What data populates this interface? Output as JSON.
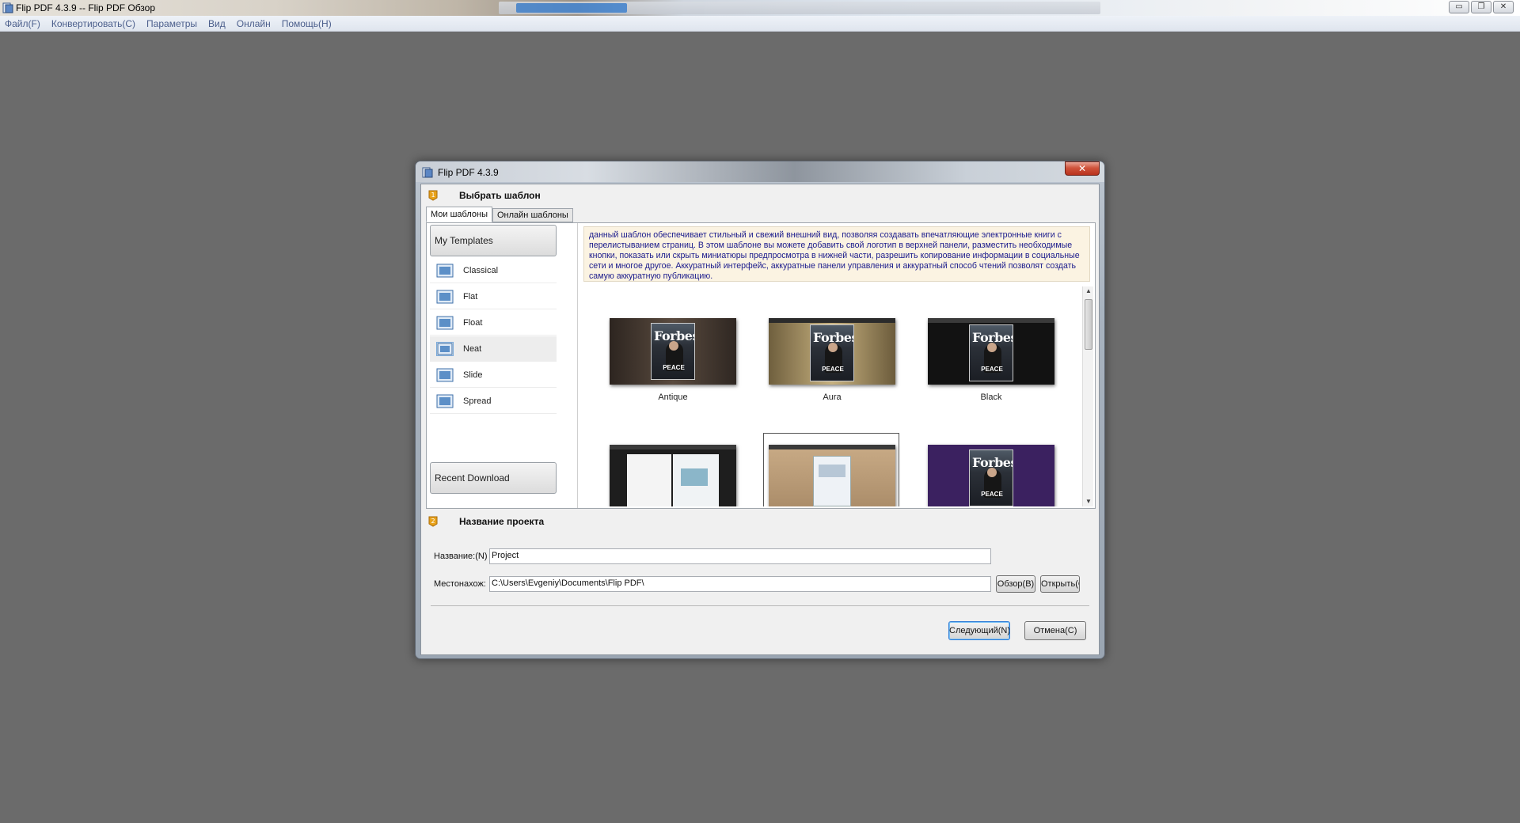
{
  "app": {
    "title": "Flip PDF 4.3.9  -- Flip PDF Обзор",
    "window_buttons": {
      "minimize": "▭",
      "restore": "❐",
      "close": "✕"
    }
  },
  "menu": {
    "items": [
      {
        "label": "Файл(F)"
      },
      {
        "label": "Конвертировать(C)"
      },
      {
        "label": "Параметры"
      },
      {
        "label": "Вид"
      },
      {
        "label": "Онлайн"
      },
      {
        "label": "Помощь(H)"
      }
    ]
  },
  "dialog": {
    "title": "Flip PDF 4.3.9",
    "close_label": "✕",
    "section1": {
      "number": "1",
      "title": "Выбрать шаблон"
    },
    "tabs": [
      {
        "label": "Мои шаблоны",
        "active": true
      },
      {
        "label": "Онлайн шаблоны",
        "active": false
      }
    ],
    "templates": {
      "header": "My Templates",
      "items": [
        {
          "label": "Classical"
        },
        {
          "label": "Flat"
        },
        {
          "label": "Float"
        },
        {
          "label": "Neat",
          "selected": true
        },
        {
          "label": "Slide"
        },
        {
          "label": "Spread"
        }
      ],
      "footer": "Recent Download"
    },
    "description": "данный шаблон обеспечивает стильный и свежий внешний вид, позволяя создавать впечатляющие электронные книги с перелистыванием страниц. В этом шаблоне вы можете добавить свой логотип в верхней панели, разместить необходимые кнопки, показать или скрыть миниатюры предпросмотра в нижней части, разрешить копирование информации в социальные сети и многое другое. Аккуратный интерфейс, аккуратные панели управления и аккуратный способ чтений позволят создать самую аккуратную публикацию.",
    "thumbnails": [
      {
        "label": "Antique",
        "cover_title": "Forbes",
        "cover_caption": "PEACE",
        "bg": "#4a3f36"
      },
      {
        "label": "Aura",
        "cover_title": "Forbes",
        "cover_caption": "PEACE",
        "bg": "#a48e61"
      },
      {
        "label": "Black",
        "cover_title": "Forbes",
        "cover_caption": "PEACE",
        "bg": "#1b1b1b"
      },
      {
        "label": "",
        "bg": "#2a2a2a"
      },
      {
        "label": "",
        "bg": "#b89a74",
        "selected": true
      },
      {
        "label": "",
        "cover_title": "Forbes",
        "cover_caption": "PEACE",
        "bg": "#3b2160"
      }
    ],
    "section2": {
      "number": "2",
      "title": "Название проекта"
    },
    "project": {
      "name_label": "Название:(N)",
      "name_value": "Project",
      "location_label": "Местонахож:",
      "location_value": "C:\\Users\\Evgeniy\\Documents\\Flip PDF\\",
      "browse_label": "Обзор(B)",
      "open_label": "Открыть(O)"
    },
    "buttons": {
      "next": "Следующий(N)",
      "cancel": "Отмена(C)"
    }
  }
}
